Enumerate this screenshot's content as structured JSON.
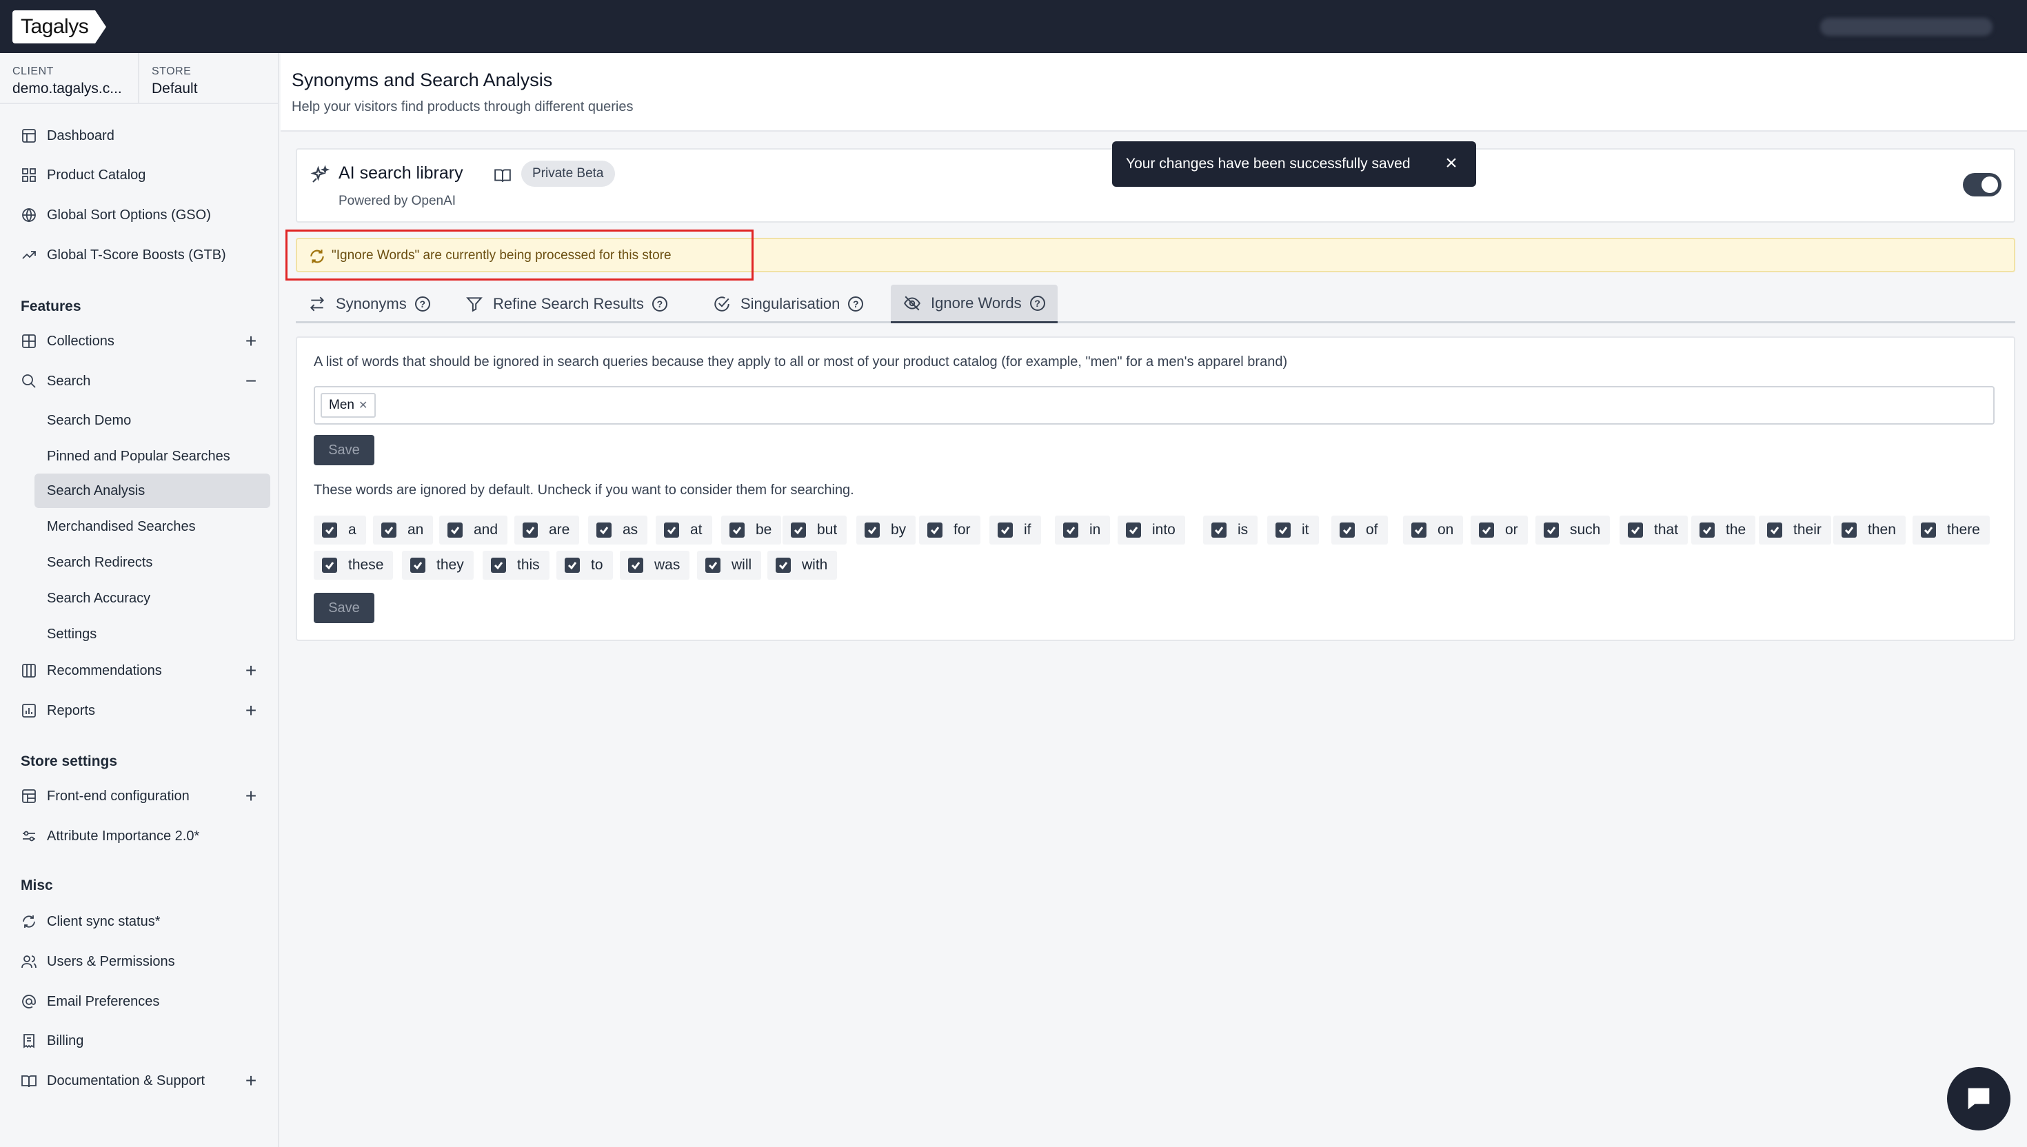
{
  "brand": {
    "logo_text": "Tagalys"
  },
  "context": {
    "client_label": "CLIENT",
    "client_value": "demo.tagalys.c...",
    "store_label": "STORE",
    "store_value": "Default"
  },
  "sidebar": {
    "top_items": [
      {
        "label": "Dashboard",
        "icon": "dashboard-icon"
      },
      {
        "label": "Product Catalog",
        "icon": "grid-icon"
      },
      {
        "label": "Global Sort Options (GSO)",
        "icon": "globe-icon"
      },
      {
        "label": "Global T-Score Boosts (GTB)",
        "icon": "trend-icon"
      }
    ],
    "features_heading": "Features",
    "features": [
      {
        "label": "Collections",
        "icon": "collections-icon",
        "control": "+"
      },
      {
        "label": "Search",
        "icon": "search-icon",
        "control": "−"
      }
    ],
    "search_sub": [
      {
        "label": "Search Demo"
      },
      {
        "label": "Pinned and Popular Searches"
      },
      {
        "label": "Search Analysis",
        "active": true
      },
      {
        "label": "Merchandised Searches"
      },
      {
        "label": "Search Redirects"
      },
      {
        "label": "Search Accuracy"
      },
      {
        "label": "Settings"
      }
    ],
    "features_more": [
      {
        "label": "Recommendations",
        "icon": "columns-icon",
        "control": "+"
      },
      {
        "label": "Reports",
        "icon": "reports-icon",
        "control": "+"
      }
    ],
    "store_heading": "Store settings",
    "store_items": [
      {
        "label": "Front-end configuration",
        "icon": "layout-icon",
        "control": "+"
      },
      {
        "label": "Attribute Importance 2.0*",
        "icon": "sliders-icon"
      }
    ],
    "misc_heading": "Misc",
    "misc_items": [
      {
        "label": "Client sync status*",
        "icon": "sync-icon"
      },
      {
        "label": "Users & Permissions",
        "icon": "users-icon"
      },
      {
        "label": "Email Preferences",
        "icon": "at-icon"
      },
      {
        "label": "Billing",
        "icon": "billing-icon"
      },
      {
        "label": "Documentation & Support",
        "icon": "book-icon",
        "control": "+"
      }
    ]
  },
  "page": {
    "title": "Synonyms and Search Analysis",
    "subtitle": "Help your visitors find products through different queries"
  },
  "toast": {
    "message": "Your changes have been successfully saved",
    "close": "×"
  },
  "ai_card": {
    "title": "AI search library",
    "badge": "Private Beta",
    "powered_by": "Powered by OpenAI",
    "enabled": true
  },
  "alert": {
    "message": "\"Ignore Words\" are currently being processed for this store"
  },
  "tabs": [
    {
      "label": "Synonyms",
      "icon": "swap-icon"
    },
    {
      "label": "Refine Search Results",
      "icon": "filter-icon"
    },
    {
      "label": "Singularisation",
      "icon": "check-circle-icon"
    },
    {
      "label": "Ignore Words",
      "icon": "eye-off-icon",
      "active": true
    }
  ],
  "ignore_words": {
    "description": "A list of words that should be ignored in search queries because they apply to all or most of your product catalog (for example, \"men\" for a men's apparel brand)",
    "custom_words": [
      "Men"
    ],
    "save_label": "Save",
    "default_description": "These words are ignored by default. Uncheck if you want to consider them for searching.",
    "default_words": [
      "a",
      "an",
      "and",
      "are",
      "as",
      "at",
      "be",
      "but",
      "by",
      "for",
      "if",
      "in",
      "into",
      "is",
      "it",
      "of",
      "on",
      "or",
      "such",
      "that",
      "the",
      "their",
      "then",
      "there",
      "these",
      "they",
      "this",
      "to",
      "was",
      "will",
      "with"
    ],
    "save_label_2": "Save"
  }
}
